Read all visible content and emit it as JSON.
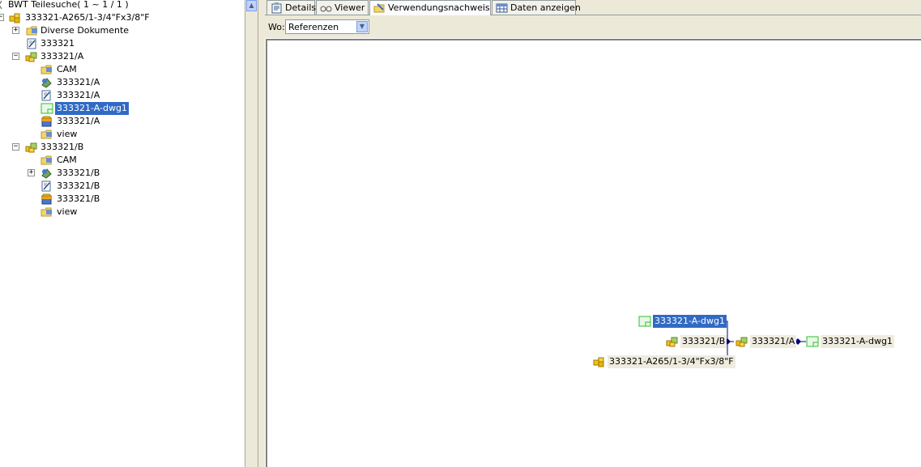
{
  "tree": {
    "root": {
      "label": "BWT Teilesuche( 1 ~ 1 / 1 )"
    },
    "items": [
      {
        "label": "333321-A265/1-3/4\"Fx3/8\"F",
        "icon": "assembly-icon",
        "expander": "−"
      },
      {
        "label": "Diverse Dokumente",
        "icon": "folder-icon",
        "expander": "+"
      },
      {
        "label": "333321",
        "icon": "document-edit-icon"
      },
      {
        "label": "333321/A",
        "icon": "part-revision-icon",
        "expander": "−"
      },
      {
        "label": "CAM",
        "icon": "folder-icon"
      },
      {
        "label": "333321/A",
        "icon": "cad-model-icon"
      },
      {
        "label": "333321/A",
        "icon": "document-edit-icon"
      },
      {
        "label": "333321-A-dwg1",
        "icon": "drawing-icon",
        "selected": true
      },
      {
        "label": "333321/A",
        "icon": "package-icon"
      },
      {
        "label": "view",
        "icon": "folder-icon"
      },
      {
        "label": "333321/B",
        "icon": "part-revision-icon",
        "expander": "−"
      },
      {
        "label": "CAM",
        "icon": "folder-icon"
      },
      {
        "label": "333321/B",
        "icon": "cad-model-icon",
        "expander": "+"
      },
      {
        "label": "333321/B",
        "icon": "document-edit-icon"
      },
      {
        "label": "333321/B",
        "icon": "package-icon"
      },
      {
        "label": "view",
        "icon": "folder-icon"
      }
    ]
  },
  "tabs": [
    {
      "label": "Details",
      "icon": "details-icon"
    },
    {
      "label": "Viewer",
      "icon": "glasses-icon"
    },
    {
      "label": "Verwendungsnachweis",
      "icon": "where-used-icon",
      "active": true
    },
    {
      "label": "Daten anzeigen",
      "icon": "table-icon"
    }
  ],
  "toolbar": {
    "wo_label": "Wo:",
    "wo_value": "Referenzen"
  },
  "graph": {
    "nodes": [
      {
        "label": "333321-A-dwg1",
        "icon": "drawing-icon",
        "selected": true
      },
      {
        "label": "333321/B",
        "icon": "part-revision-icon"
      },
      {
        "label": "333321-A265/1-3/4\"Fx3/8\"F",
        "icon": "assembly-icon"
      },
      {
        "label": "333321/A",
        "icon": "part-revision-icon"
      },
      {
        "label": "333321-A-dwg1",
        "icon": "drawing-icon"
      }
    ]
  },
  "colors": {
    "selection": "#316ac5",
    "connector": "#00007f",
    "panel_bg": "#ece9d8"
  }
}
